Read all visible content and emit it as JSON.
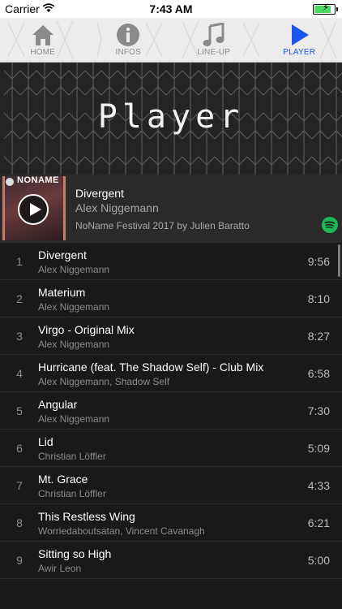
{
  "status_bar": {
    "carrier": "Carrier",
    "time": "7:43 AM",
    "battery_color": "#4cd964"
  },
  "tabs": [
    {
      "label": "HOME",
      "icon": "home-icon",
      "active": false
    },
    {
      "label": "INFOS",
      "icon": "info-icon",
      "active": false
    },
    {
      "label": "LINE-UP",
      "icon": "music-note-icon",
      "active": false
    },
    {
      "label": "PLAYER",
      "icon": "play-icon",
      "active": true
    }
  ],
  "accent_color": "#1a55f2",
  "hero": {
    "title": "Player"
  },
  "now_playing": {
    "title": "Divergent",
    "artist": "Alex Niggemann",
    "playlist": "NoName Festival 2017 by Julien Baratto",
    "cover_text": "NONAME",
    "service_icon": "spotify-icon",
    "service_color": "#1db954"
  },
  "tracks": [
    {
      "number": "1",
      "title": "Divergent",
      "artist": "Alex Niggemann",
      "duration": "9:56"
    },
    {
      "number": "2",
      "title": "Materium",
      "artist": "Alex Niggemann",
      "duration": "8:10"
    },
    {
      "number": "3",
      "title": "Virgo - Original Mix",
      "artist": "Alex Niggemann",
      "duration": "8:27"
    },
    {
      "number": "4",
      "title": "Hurricane (feat. The Shadow Self) - Club Mix",
      "artist": "Alex Niggemann, Shadow Self",
      "duration": "6:58"
    },
    {
      "number": "5",
      "title": "Angular",
      "artist": "Alex Niggemann",
      "duration": "7:30"
    },
    {
      "number": "6",
      "title": "Lid",
      "artist": "Christian Löffler",
      "duration": "5:09"
    },
    {
      "number": "7",
      "title": "Mt. Grace",
      "artist": "Christian Löffler",
      "duration": "4:33"
    },
    {
      "number": "8",
      "title": "This Restless Wing",
      "artist": "Worriedaboutsatan, Vincent Cavanagh",
      "duration": "6:21"
    },
    {
      "number": "9",
      "title": "Sitting so High",
      "artist": "Awir Leon",
      "duration": "5:00"
    }
  ]
}
